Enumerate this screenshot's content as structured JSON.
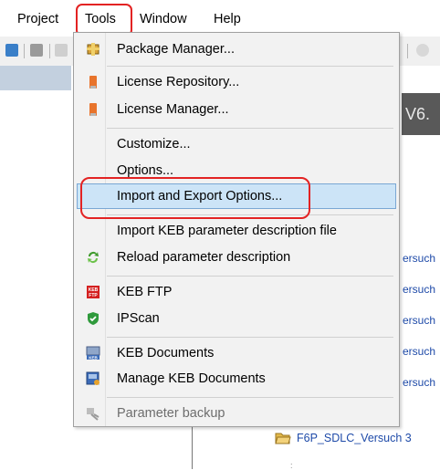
{
  "menubar": {
    "items": [
      "Project",
      "Tools",
      "Window",
      "Help"
    ]
  },
  "background": {
    "version_text": "V6.",
    "links": [
      "ersuch",
      "ersuch",
      "ersuch",
      "ersuch",
      "ersuch"
    ],
    "tree_item": "F6P_SDLC_Versuch 3"
  },
  "tools_menu": {
    "items": [
      {
        "label": "Package Manager...",
        "icon": "package-icon"
      },
      {
        "label": "License Repository...",
        "icon": "license-icon"
      },
      {
        "label": "License Manager...",
        "icon": "license-icon"
      },
      {
        "label": "Customize...",
        "icon": ""
      },
      {
        "label": "Options...",
        "icon": ""
      },
      {
        "label": "Import and Export Options...",
        "icon": "",
        "selected": true
      },
      {
        "label": "Import KEB parameter description file",
        "icon": ""
      },
      {
        "label": "Reload parameter description",
        "icon": "reload-icon"
      },
      {
        "label": "KEB FTP",
        "icon": "keb-ftp-icon"
      },
      {
        "label": "IPScan",
        "icon": "shield-icon"
      },
      {
        "label": "KEB Documents",
        "icon": "keb-documents-icon"
      },
      {
        "label": "Manage KEB Documents",
        "icon": "manage-documents-icon"
      },
      {
        "label": "Parameter backup",
        "icon": "parameter-backup-icon",
        "disabled": true
      }
    ]
  },
  "colors": {
    "highlight_red": "#e32323",
    "selection_blue": "#cce4f7",
    "selection_border": "#7aa7d4"
  }
}
